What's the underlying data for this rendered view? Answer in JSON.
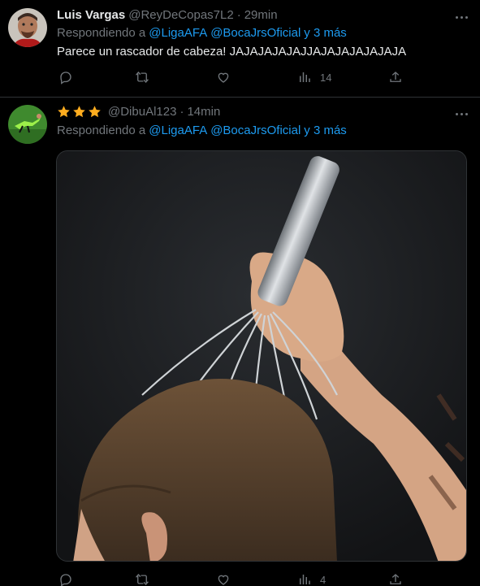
{
  "tweets": [
    {
      "name": "Luis Vargas",
      "handle": "@ReyDeCopas7L2",
      "separator": "·",
      "time": "29min",
      "reply_prefix": "Respondiendo a",
      "mention_1": "@LigaAFA",
      "mention_2": "@BocaJrsOficial",
      "reply_suffix": "y 3 más",
      "text": "Parece un rascador de cabeza! JAJAJAJAJAJJAJAJAJAJAJAJA",
      "views": "14"
    },
    {
      "name_icons": [
        "star-icon",
        "star-icon",
        "star-icon"
      ],
      "handle": "@DibuAl123",
      "separator": "·",
      "time": "14min",
      "reply_prefix": "Respondiendo a",
      "mention_1": "@LigaAFA",
      "mention_2": "@BocaJrsOficial",
      "reply_suffix": "y 3 más",
      "image": "head-scratcher-photo",
      "views": "4"
    }
  ],
  "colors": {
    "background": "#000000",
    "text": "#e7e9ea",
    "secondary": "#71767b",
    "link": "#1d9bf0",
    "star": "#ffad1f",
    "divider": "#2f3336"
  }
}
